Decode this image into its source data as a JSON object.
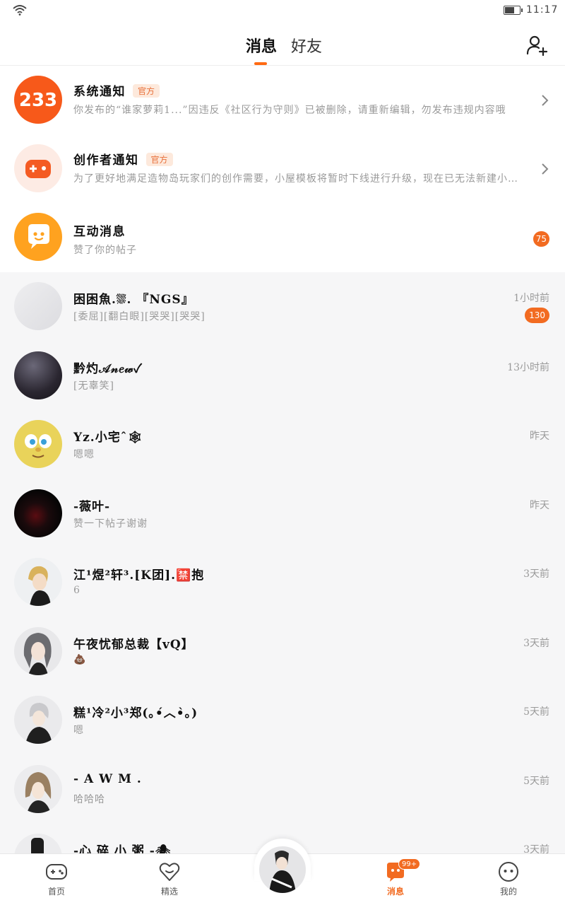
{
  "status_bar": {
    "time": "11:17",
    "icons": [
      "wifi-icon",
      "battery-icon"
    ]
  },
  "header": {
    "tabs": [
      {
        "label": "消息",
        "active": true
      },
      {
        "label": "好友",
        "active": false
      }
    ],
    "add_friend_icon": "add-user-icon"
  },
  "notices": [
    {
      "title": "系统通知",
      "badge": "官方",
      "subtitle": "你发布的“谁家萝莉1...”因违反《社区行为守则》已被删除，请重新编辑，勿发布违规内容哦",
      "avatar_text": "233",
      "avatar_color": "#f7591a"
    },
    {
      "title": "创作者通知",
      "badge": "官方",
      "subtitle": "为了更好地满足造物岛玩家们的创作需要，小屋模板将暂时下线进行升级，现在已无法新建小屋…",
      "avatar_icon": "gamepad-icon",
      "avatar_color": "#fdebe4"
    },
    {
      "title": "互动消息",
      "subtitle": "赞了你的帖子",
      "count": "75",
      "avatar_icon": "speech-bubble-icon",
      "avatar_color": "#ffa21f"
    }
  ],
  "chats": [
    {
      "name": "困困魚.⛆. 『NGS』",
      "message": "[委屈][翻白眼][哭哭][哭哭]",
      "time": "1小时前",
      "count": "130"
    },
    {
      "name": "黔灼𝒜𝓃𝑒𝓌✓",
      "message": "[无辜笑]",
      "time": "13小时前"
    },
    {
      "name": "Yz.小宅ˆ🕸",
      "message": "嗯嗯",
      "time": "昨天"
    },
    {
      "name": "-薇叶-",
      "message": "赞一下帖子谢谢",
      "time": "昨天"
    },
    {
      "name": "江¹煜²轩³.[K团].🈲抱",
      "message": "6",
      "time": "3天前"
    },
    {
      "name": "午夜忧郁总裁【vQ】",
      "message": "💩",
      "time": "3天前"
    },
    {
      "name": "糕¹冷²小³郑(｡•́︿•̀｡)",
      "message": "嗯",
      "time": "5天前"
    },
    {
      "name": "- A W M .",
      "message": "哈哈哈",
      "time": "5天前"
    },
    {
      "name": "-心 碎 小 粥 -🕷",
      "message": "",
      "time": "3天前"
    }
  ],
  "bottom_nav": [
    {
      "label": "首页",
      "icon": "gamepad-icon"
    },
    {
      "label": "精选",
      "icon": "heart-icon"
    },
    {
      "label": "",
      "icon": "avatar-center"
    },
    {
      "label": "消息",
      "icon": "message-icon",
      "badge": "99+",
      "active": true
    },
    {
      "label": "我的",
      "icon": "face-icon"
    }
  ],
  "colors": {
    "accent": "#f26b21",
    "list_bg": "#f6f6f7"
  }
}
